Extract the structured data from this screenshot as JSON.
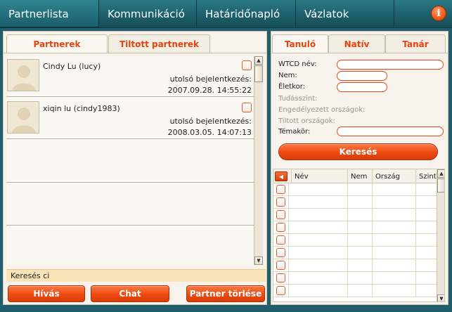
{
  "nav": {
    "tabs": [
      "Partnerlista",
      "Kommunikáció",
      "Határidőnapló",
      "Vázlatok"
    ],
    "info_glyph": "i"
  },
  "left": {
    "tabs": [
      "Partnerek",
      "Tiltott partnerek"
    ],
    "partners": [
      {
        "name": "Cindy Lu (lucy)",
        "last_label": "utolsó bejelentkezés:",
        "last_date": "2007.09.28. 14:55:22"
      },
      {
        "name": "xiqin lu (cindy1983)",
        "last_label": "utolsó bejelentkezés:",
        "last_date": "2008.03.05. 14:07:13"
      }
    ],
    "search_text": "Keresés   ci",
    "buttons": {
      "call": "Hívás",
      "chat": "Chat",
      "delete": "Partner törlése"
    }
  },
  "right": {
    "tabs": [
      "Tanuló",
      "Natív",
      "Tanár"
    ],
    "form": {
      "name_label": "WTCD név:",
      "gender_label": "Nem:",
      "age_label": "Életkor:",
      "level_label": "Tudásszint:",
      "allowed_label": "Engedélyezett országok:",
      "banned_label": "Tiltott országok:",
      "topic_label": "Témakör:"
    },
    "search_button": "Keresés",
    "grid": {
      "headers": [
        "Név",
        "Nem",
        "Ország",
        "Szint"
      ],
      "arrow_glyph": "◀",
      "row_count": 9
    }
  },
  "icons": {
    "avatar": "user-avatar-icon",
    "scroll_up": "▲",
    "scroll_down": "▼"
  }
}
